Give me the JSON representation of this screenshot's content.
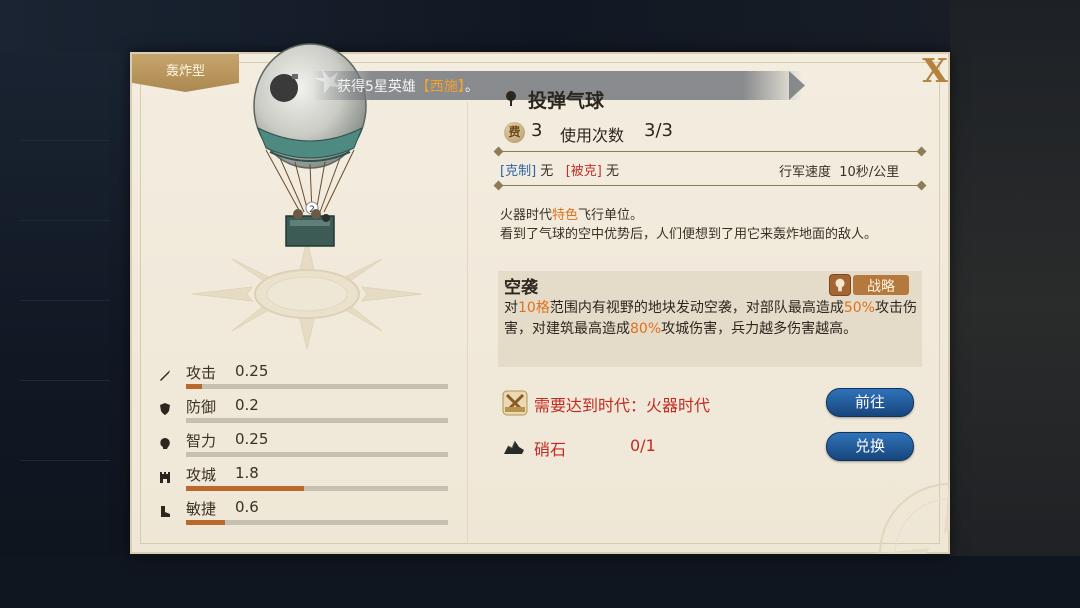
{
  "panel": {
    "type_tag": "轰炸型",
    "close_label": "X",
    "notice": {
      "prefix": "获得5星英雄",
      "hero": "【西施】",
      "suffix": "。"
    }
  },
  "stats": [
    {
      "label": "攻击",
      "value": "0.25",
      "fill": 0.06,
      "icon": "sword-icon"
    },
    {
      "label": "防御",
      "value": "0.2",
      "fill": 0.0,
      "icon": "shield-icon"
    },
    {
      "label": "智力",
      "value": "0.25",
      "fill": 0.0,
      "icon": "brain-icon"
    },
    {
      "label": "攻城",
      "value": "1.8",
      "fill": 0.45,
      "icon": "castle-icon"
    },
    {
      "label": "敏捷",
      "value": "0.6",
      "fill": 0.15,
      "icon": "boot-icon"
    }
  ],
  "unit": {
    "name": "投弹气球",
    "cost_icon_label": "费",
    "cost": "3",
    "uses_label": "使用次数",
    "uses_value": "3/3",
    "counter_label": "[克制]",
    "counter_value": "无",
    "countered_label": "[被克]",
    "countered_value": "无",
    "march_label": "行军速度",
    "march_value": "10秒/公里",
    "desc_line1_a": "火器时代",
    "desc_line1_hl": "特色",
    "desc_line1_b": "飞行单位。",
    "desc_line2": "看到了气球的空中优势后，人们便想到了用它来轰炸地面的敌人。"
  },
  "skill": {
    "name": "空袭",
    "tag": "战略",
    "desc_p1": "对",
    "desc_hl1": "10格",
    "desc_p2": "范围内有视野的地块发动空袭，对部队最高造成",
    "desc_hl2": "50%",
    "desc_p3": "攻击伤害，对建筑最高造成",
    "desc_hl3": "80%",
    "desc_p4": "攻城伤害，兵力越多伤害越高。"
  },
  "requirement": {
    "text": "需要达到时代：火器时代",
    "button": "前往"
  },
  "resource": {
    "name": "硝石",
    "count": "0/1",
    "button": "兑换"
  },
  "colors": {
    "accent_orange": "#e0711e",
    "warning_red": "#c42a22",
    "button_blue": "#1f5b9c",
    "bar_fill": "#b96a2a"
  }
}
